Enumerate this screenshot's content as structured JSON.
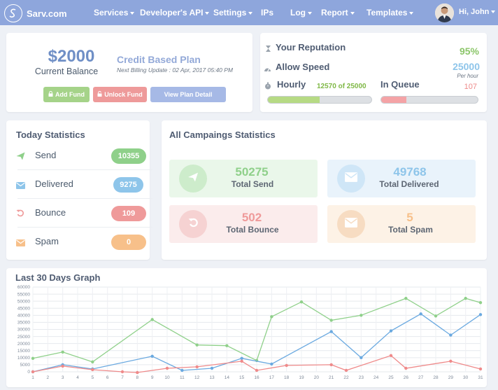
{
  "nav": {
    "brand": "Sarv.com",
    "items": [
      "Services",
      "Developer's API",
      "Settings",
      "IPs",
      "Log",
      "Report",
      "Templates"
    ],
    "user": "Hi, John"
  },
  "balance": {
    "amount": "$2000",
    "label": "Current Balance",
    "plan": "Credit Based Plan",
    "billing": "Next Billing Update : 02 Apr, 2017 05:40 PM",
    "add_fund": "Add Fund",
    "unlock_fund": "Unlock Fund",
    "view_plan": "View Plan Detail"
  },
  "reputation": {
    "label": "Your  Reputation",
    "value": "95%",
    "speed_label": "Allow  Speed",
    "speed_value": "25000",
    "speed_unit": "Per hour",
    "hourly_label": "Hourly",
    "hourly_value": "12570 of 25000",
    "hourly_fraction": 0.5028,
    "queue_label": "In Queue",
    "queue_value": "107",
    "queue_fraction": 0.26
  },
  "today": {
    "title": "Today Statistics",
    "rows": [
      {
        "label": "Send",
        "value": "10355",
        "color": "#8fd08a"
      },
      {
        "label": "Delivered",
        "value": "9275",
        "color": "#8ec5ea"
      },
      {
        "label": "Bounce",
        "value": "109",
        "color": "#ef9a9a"
      },
      {
        "label": "Spam",
        "value": "0",
        "color": "#f7c08a"
      }
    ]
  },
  "campaigns": {
    "title": "All Campaings Statistics",
    "tiles": [
      {
        "number": "50275",
        "label": "Total Send",
        "color": "#8fd08a",
        "bg": "#eaf7ea"
      },
      {
        "number": "49768",
        "label": "Total Delivered",
        "color": "#8ec5ea",
        "bg": "#e9f3fb"
      },
      {
        "number": "502",
        "label": "Total Bounce",
        "color": "#ef9a9a",
        "bg": "#fbecec"
      },
      {
        "number": "5",
        "label": "Total Spam",
        "color": "#f7c08a",
        "bg": "#fdf2e6"
      }
    ]
  },
  "chart_data": {
    "type": "line",
    "title": "Last 30 Days Graph",
    "xlabel": "",
    "ylabel": "",
    "x": [
      1,
      2,
      3,
      4,
      5,
      6,
      7,
      8,
      9,
      10,
      11,
      12,
      13,
      14,
      15,
      16,
      17,
      18,
      19,
      20,
      21,
      22,
      23,
      24,
      25,
      26,
      27,
      28,
      29,
      30,
      31
    ],
    "ylim": [
      0,
      60000
    ],
    "yticks": [
      0,
      5000,
      10000,
      15000,
      20000,
      25000,
      30000,
      35000,
      40000,
      45000,
      50000,
      55000,
      60000
    ],
    "grid": true,
    "series": [
      {
        "color": "#8fd08a",
        "points": [
          [
            1,
            9500
          ],
          [
            3,
            14000
          ],
          [
            5,
            7000
          ],
          [
            9,
            37000
          ],
          [
            12,
            19000
          ],
          [
            14,
            18500
          ],
          [
            16,
            8000
          ],
          [
            17,
            39000
          ],
          [
            19,
            49500
          ],
          [
            21,
            36500
          ],
          [
            23,
            40000
          ],
          [
            26,
            52000
          ],
          [
            28,
            39500
          ],
          [
            30,
            52000
          ],
          [
            31,
            49000
          ]
        ]
      },
      {
        "color": "#6aa9e0",
        "points": [
          [
            1,
            0
          ],
          [
            3,
            5000
          ],
          [
            5,
            2000
          ],
          [
            9,
            11000
          ],
          [
            11,
            1000
          ],
          [
            13,
            2500
          ],
          [
            15,
            9500
          ],
          [
            17,
            5500
          ],
          [
            21,
            28500
          ],
          [
            23,
            10000
          ],
          [
            25,
            29000
          ],
          [
            27,
            41000
          ],
          [
            29,
            26000
          ],
          [
            31,
            40500
          ]
        ]
      },
      {
        "color": "#ef8a8a",
        "points": [
          [
            1,
            0
          ],
          [
            3,
            4000
          ],
          [
            5,
            1500
          ],
          [
            7,
            0
          ],
          [
            8,
            -500
          ],
          [
            10,
            2500
          ],
          [
            12,
            3500
          ],
          [
            15,
            7500
          ],
          [
            16,
            1000
          ],
          [
            18,
            4500
          ],
          [
            21,
            5000
          ],
          [
            22,
            1000
          ],
          [
            25,
            11500
          ],
          [
            26,
            2500
          ],
          [
            29,
            7500
          ],
          [
            31,
            2000
          ]
        ]
      }
    ]
  }
}
